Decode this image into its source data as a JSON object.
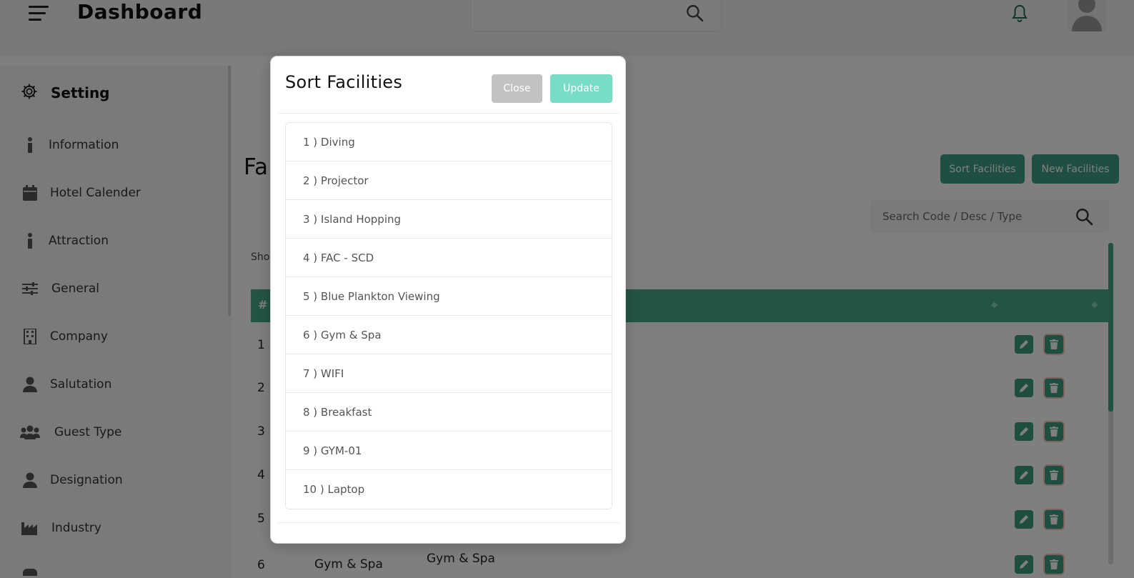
{
  "header": {
    "title": "Dashboard"
  },
  "sidebar": {
    "heading": "Setting",
    "items": [
      {
        "label": "Information",
        "icon": "info-icon"
      },
      {
        "label": "Hotel Calender",
        "icon": "calendar-icon"
      },
      {
        "label": "Attraction",
        "icon": "info-icon"
      },
      {
        "label": "General",
        "icon": "sliders-icon"
      },
      {
        "label": "Company",
        "icon": "building-icon"
      },
      {
        "label": "Salutation",
        "icon": "user-icon"
      },
      {
        "label": "Guest Type",
        "icon": "users-icon"
      },
      {
        "label": "Designation",
        "icon": "user-icon"
      },
      {
        "label": "Industry",
        "icon": "industry-icon"
      }
    ]
  },
  "main": {
    "title": "Fa",
    "sort_button": "Sort Facilities",
    "new_button": "New Facilities",
    "search_placeholder": "Search Code / Desc / Type",
    "show_label": "Sho",
    "table_hash": "#",
    "rows": [
      "1",
      "2",
      "3",
      "4",
      "5",
      "6"
    ],
    "row6_col2": "Gym & Spa",
    "row6_col3": "Gym & Spa"
  },
  "modal": {
    "title": "Sort Facilities",
    "close_label": "Close",
    "update_label": "Update",
    "items": [
      "1 ) Diving",
      "2 ) Projector",
      "3 ) Island Hopping",
      "4 ) FAC - SCD",
      "5 ) Blue Plankton Viewing",
      "6 ) Gym & Spa",
      "7 ) WIFI",
      "8 ) Breakfast",
      "9 ) GYM-01",
      "10 ) Laptop"
    ]
  },
  "colors": {
    "accent": "#3f9f84",
    "update": "#79dcc7",
    "close": "#c2c2c2"
  }
}
